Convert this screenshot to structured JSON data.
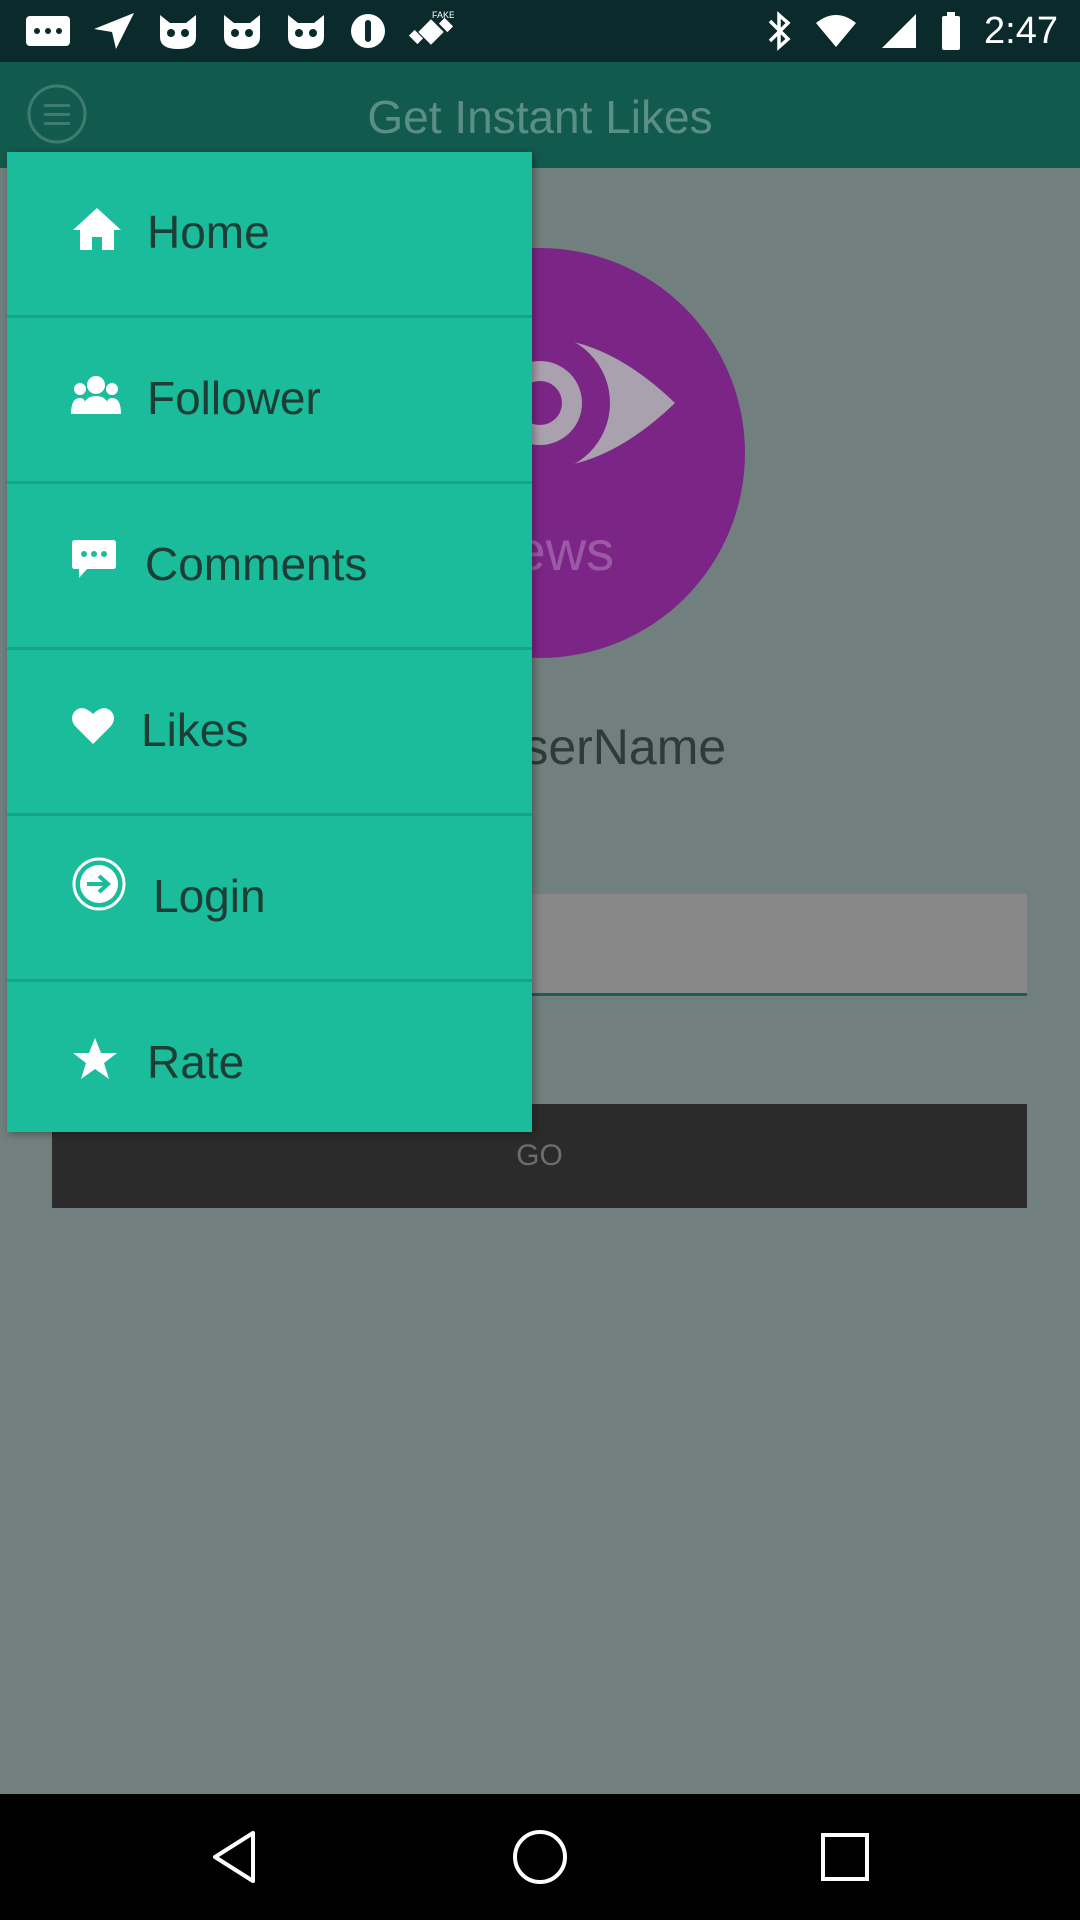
{
  "status_bar": {
    "time": "2:47",
    "left_icons": [
      "message-icon",
      "navigation-icon",
      "cat-app-icon",
      "cat-app-icon",
      "cat-app-icon",
      "circle-app-icon",
      "fake-gps-icon"
    ],
    "right_icons": [
      "bluetooth-icon",
      "wifi-icon",
      "signal-icon",
      "battery-icon"
    ]
  },
  "app_bar": {
    "title": "Get Instant Likes",
    "menu_icon": "hamburger-menu-icon"
  },
  "main": {
    "views_circle_label": "Views",
    "username_label": "Enter UserName",
    "username_value": "",
    "go_button_label": "GO"
  },
  "drawer": {
    "items": [
      {
        "label": "Home",
        "icon": "home-icon"
      },
      {
        "label": "Follower",
        "icon": "group-icon"
      },
      {
        "label": "Comments",
        "icon": "comment-icon"
      },
      {
        "label": "Likes",
        "icon": "heart-icon"
      },
      {
        "label": "Login",
        "icon": "login-arrow-icon"
      },
      {
        "label": "Rate",
        "icon": "star-icon"
      }
    ]
  },
  "nav_bar": {
    "buttons": [
      "back-icon",
      "home-circle-icon",
      "recents-icon"
    ]
  },
  "colors": {
    "status_bar": "#0a2a2b",
    "app_bar": "#135a4e",
    "drawer": "#1abc9c",
    "scrim_content": "#71807f",
    "views_circle": "#7b2586",
    "go_button": "#2b2b2b"
  }
}
